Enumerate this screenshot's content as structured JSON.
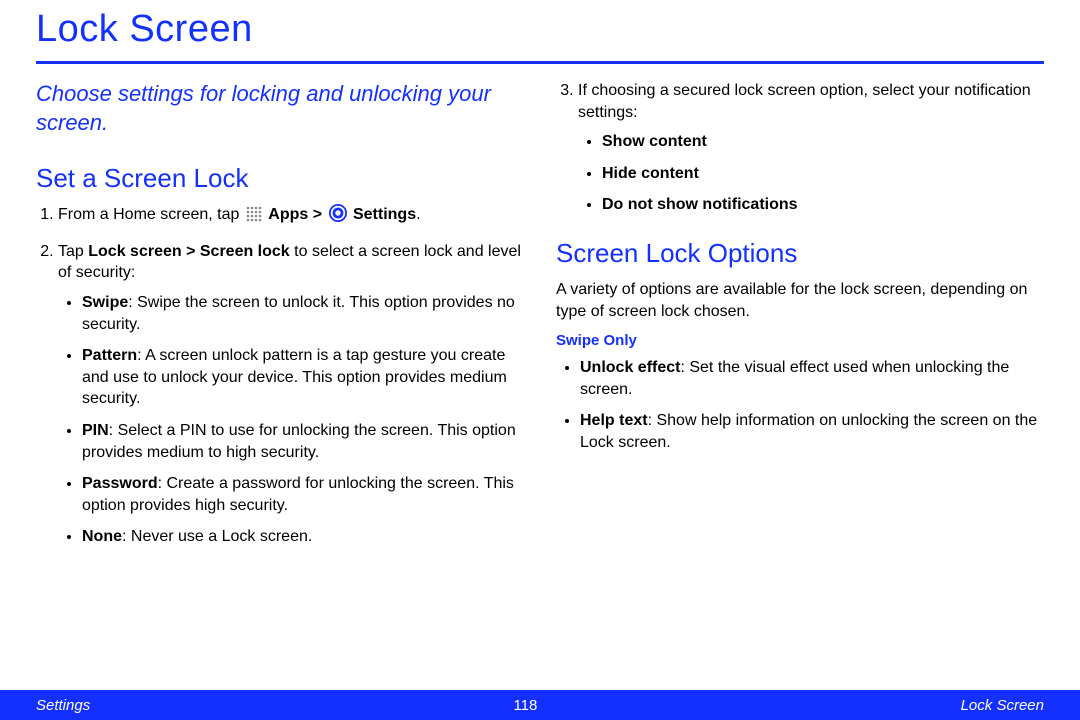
{
  "title": "Lock Screen",
  "intro": "Choose settings for locking and unlocking your screen.",
  "left": {
    "heading": "Set a Screen Lock",
    "step1_a": "From a Home screen, tap ",
    "step1_apps": "Apps > ",
    "step1_settings": "Settings",
    "step1_end": ".",
    "step2_a": "Tap ",
    "step2_b": "Lock screen > Screen lock",
    "step2_c": " to select a screen lock and level of security:",
    "opts": {
      "swipe_b": "Swipe",
      "swipe_t": ": Swipe the screen to unlock it. This option provides no security.",
      "pattern_b": "Pattern",
      "pattern_t": ": A screen unlock pattern is a tap gesture you create and use to unlock your device. This option provides medium security.",
      "pin_b": "PIN",
      "pin_t": ": Select a PIN to use for unlocking the screen. This option provides medium to high security.",
      "password_b": "Password",
      "password_t": ": Create a password for unlocking the screen. This option provides high security.",
      "none_b": "None",
      "none_t": ": Never use a Lock screen."
    }
  },
  "right": {
    "step3": "If choosing a secured lock screen option, select your notification settings:",
    "notif": {
      "a": "Show content",
      "b": "Hide content",
      "c": "Do not show notifications"
    },
    "heading": "Screen Lock Options",
    "body": "A variety of options are available for the lock screen, depending on type of screen lock chosen.",
    "subhead": "Swipe Only",
    "swipe_opts": {
      "unlock_b": "Unlock effect",
      "unlock_t": ": Set the visual effect used when unlocking the screen.",
      "help_b": "Help text",
      "help_t": ": Show help information on unlocking the screen on the Lock screen."
    }
  },
  "footer": {
    "left": "Settings",
    "center": "118",
    "right": "Lock Screen"
  }
}
